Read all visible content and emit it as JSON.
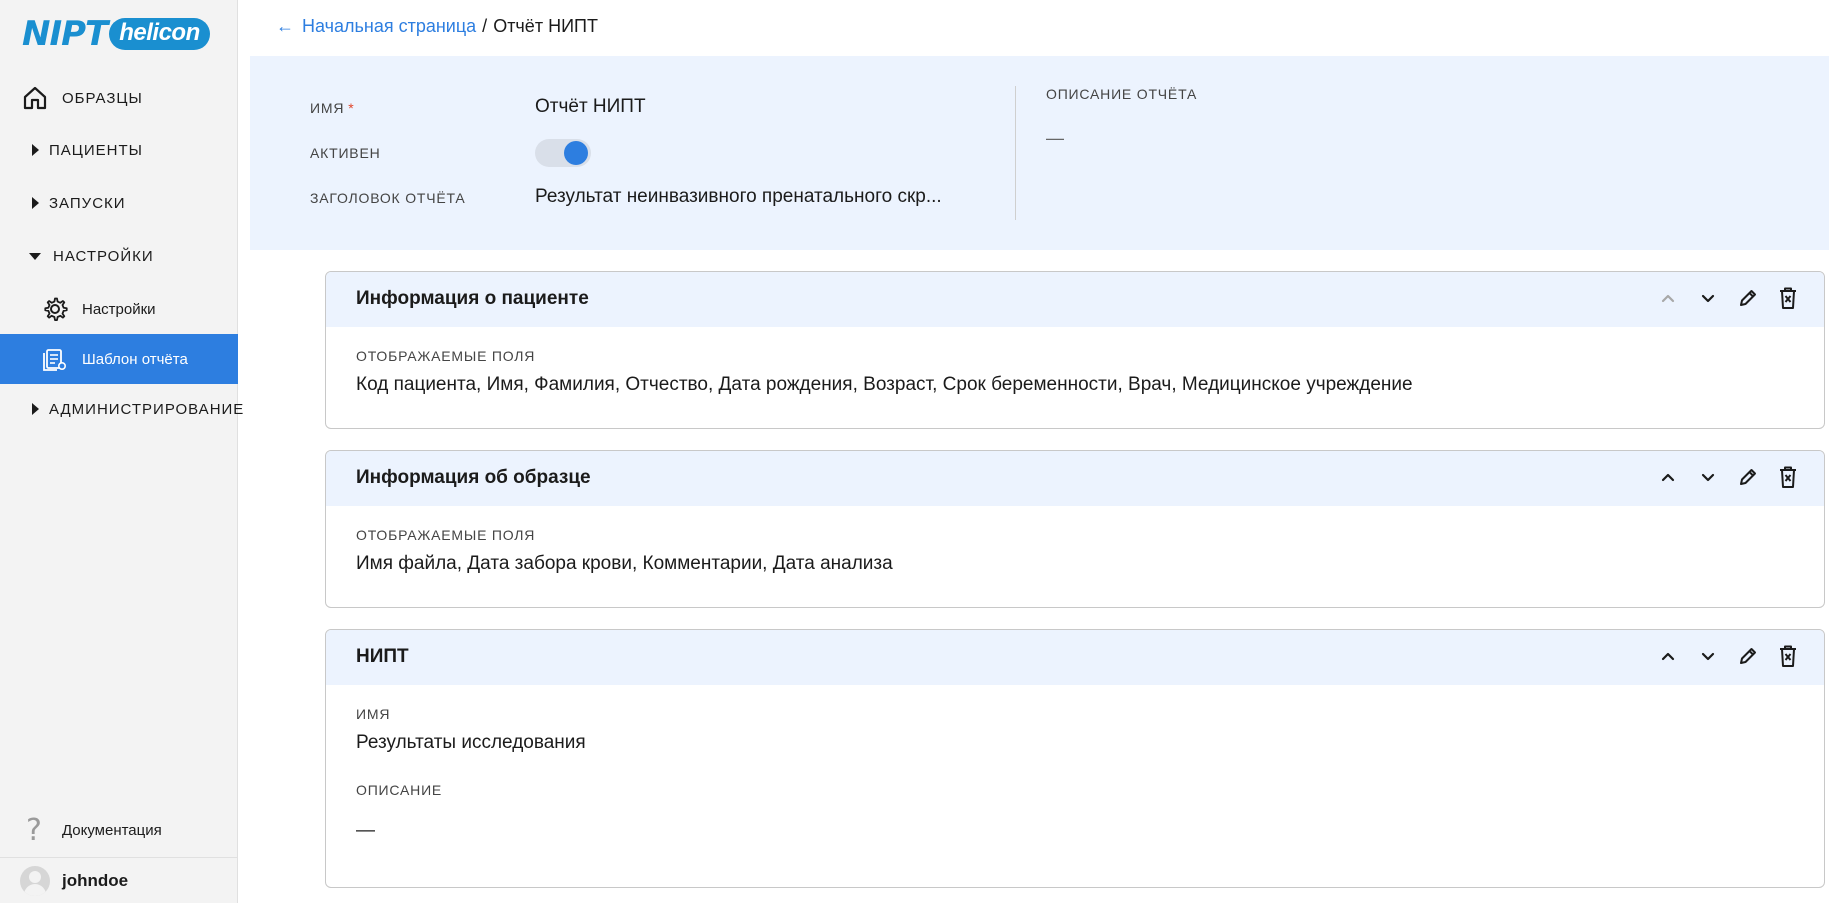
{
  "logo": {
    "part1": "NIPT",
    "part2": "helicon"
  },
  "sidebar": {
    "items": [
      {
        "label": "ОБРАЗЦЫ"
      },
      {
        "label": "ПАЦИЕНТЫ"
      },
      {
        "label": "ЗАПУСКИ"
      },
      {
        "label": "НАСТРОЙКИ"
      },
      {
        "label": "Настройки"
      },
      {
        "label": "Шаблон отчёта"
      },
      {
        "label": "АДМИНИСТРИРОВАНИЕ"
      }
    ],
    "docs_label": "Документация",
    "help_glyph": "?",
    "username": "johndoe"
  },
  "breadcrumb": {
    "back_arrow": "←",
    "home": "Начальная страница",
    "separator": "/",
    "current": "Отчёт НИПТ"
  },
  "report": {
    "name_label": "ИМЯ",
    "required_mark": "*",
    "name_value": "Отчёт НИПТ",
    "active_label": "АКТИВЕН",
    "active": 1,
    "title_label": "ЗАГОЛОВОК ОТЧЁТА",
    "title_value": "Результат неинвазивного пренатального скр...",
    "desc_label": "ОПИСАНИЕ ОТЧЁТА",
    "desc_value": "—"
  },
  "sections": [
    {
      "title": "Информация о пациенте",
      "field_label": "ОТОБРАЖАЕМЫЕ ПОЛЯ",
      "field_value": "Код пациента, Имя, Фамилия, Отчество, Дата рождения, Возраст, Срок беременности, Врач, Медицинское учреждение"
    },
    {
      "title": "Информация об образце",
      "field_label": "ОТОБРАЖАЕМЫЕ ПОЛЯ",
      "field_value": "Имя файла, Дата забора крови, Комментарии, Дата анализа"
    },
    {
      "title": "НИПТ",
      "name_label": "ИМЯ",
      "name_value": "Результаты исследования",
      "desc_label": "ОПИСАНИЕ",
      "desc_value": "—"
    }
  ],
  "colors": {
    "accent": "#2d7ee0",
    "brand": "#1a8fd0",
    "panel": "#ecf3fe",
    "sidebar": "#f3f3f3"
  }
}
